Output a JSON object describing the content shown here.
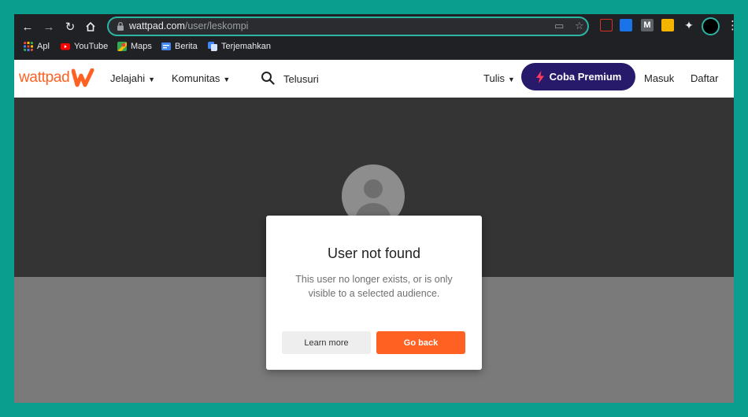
{
  "browser": {
    "url_host": "wattpad.com",
    "url_path": "/user/leskompi"
  },
  "bookmarks": [
    {
      "label": "Apl",
      "icon": "apps-grid-icon",
      "color": "#ea4335"
    },
    {
      "label": "YouTube",
      "icon": "youtube-icon",
      "color": "#ff0000"
    },
    {
      "label": "Maps",
      "icon": "maps-icon",
      "color": "#34a853"
    },
    {
      "label": "Berita",
      "icon": "news-icon",
      "color": "#4285f4"
    },
    {
      "label": "Terjemahkan",
      "icon": "translate-icon",
      "color": "#4285f4"
    }
  ],
  "nav": {
    "logo": "wattpad",
    "explore": "Jelajahi",
    "community": "Komunitas",
    "search": "Telusuri",
    "write": "Tulis",
    "premium": "Coba Premium",
    "login": "Masuk",
    "signup": "Daftar"
  },
  "modal": {
    "title": "User not found",
    "message": "This user no longer exists, or is only visible to a selected audience.",
    "learn_more": "Learn more",
    "go_back": "Go back"
  },
  "colors": {
    "brand": "#ff6122",
    "premium": "#281a6b",
    "omnibox_border": "#2bb5a3"
  }
}
